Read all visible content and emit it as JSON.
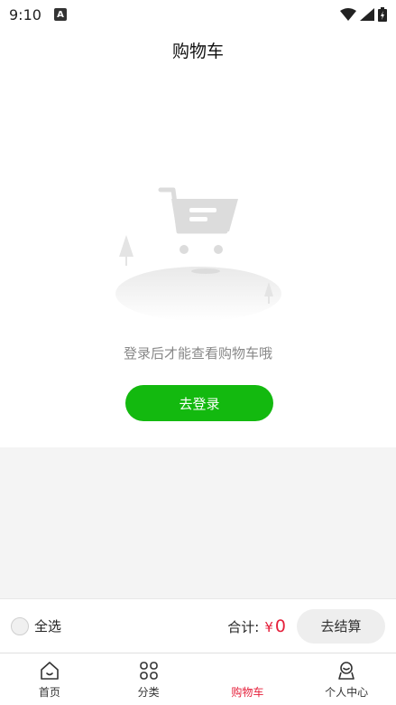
{
  "status_bar": {
    "time": "9:10"
  },
  "header": {
    "title": "购物车"
  },
  "empty_state": {
    "message": "登录后才能查看购物车哦",
    "login_button": "去登录"
  },
  "checkout": {
    "select_all_label": "全选",
    "total_label": "合计:",
    "currency": "¥",
    "amount": "0",
    "checkout_button": "去结算"
  },
  "tabs": [
    {
      "label": "首页",
      "icon": "home-icon",
      "active": false
    },
    {
      "label": "分类",
      "icon": "category-icon",
      "active": false
    },
    {
      "label": "购物车",
      "icon": "cart-icon",
      "active": true
    },
    {
      "label": "个人中心",
      "icon": "profile-icon",
      "active": false
    }
  ],
  "colors": {
    "accent_green": "#13b90f",
    "price_red": "#e5203b"
  }
}
